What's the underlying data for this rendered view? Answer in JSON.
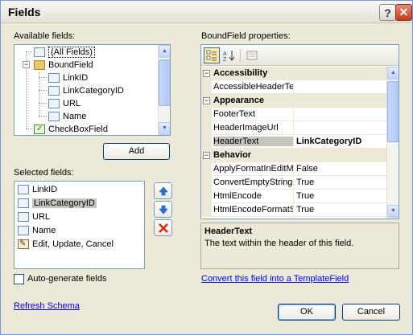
{
  "window": {
    "title": "Fields"
  },
  "available": {
    "label": "Available fields:",
    "items": [
      {
        "label": "(All Fields)",
        "icon": "all-fields-icon"
      },
      {
        "label": "BoundField",
        "icon": "bound-field-icon"
      },
      {
        "label": "LinkID",
        "icon": "field-icon"
      },
      {
        "label": "LinkCategoryID",
        "icon": "field-icon"
      },
      {
        "label": "URL",
        "icon": "field-icon"
      },
      {
        "label": "Name",
        "icon": "field-icon"
      },
      {
        "label": "CheckBoxField",
        "icon": "checkbox-field-icon"
      }
    ],
    "expander_symbol": "−"
  },
  "buttons": {
    "add": "Add",
    "ok": "OK",
    "cancel": "Cancel"
  },
  "selected": {
    "label": "Selected fields:",
    "items": [
      {
        "label": "LinkID",
        "icon": "field-icon"
      },
      {
        "label": "LinkCategoryID",
        "icon": "field-icon",
        "selected": true
      },
      {
        "label": "URL",
        "icon": "field-icon"
      },
      {
        "label": "Name",
        "icon": "field-icon"
      },
      {
        "label": "Edit, Update, Cancel",
        "icon": "command-field-icon"
      }
    ]
  },
  "autogen": {
    "label": "Auto-generate fields",
    "checked": false
  },
  "links": {
    "refresh": "Refresh Schema",
    "convert": "Convert this field into a TemplateField"
  },
  "properties": {
    "label": "BoundField properties:",
    "rows": [
      {
        "type": "category",
        "name": "Accessibility"
      },
      {
        "type": "prop",
        "name": "AccessibleHeaderTe",
        "value": ""
      },
      {
        "type": "category",
        "name": "Appearance"
      },
      {
        "type": "prop",
        "name": "FooterText",
        "value": ""
      },
      {
        "type": "prop",
        "name": "HeaderImageUrl",
        "value": ""
      },
      {
        "type": "prop",
        "name": "HeaderText",
        "value": "LinkCategoryID",
        "selected": true
      },
      {
        "type": "category",
        "name": "Behavior"
      },
      {
        "type": "prop",
        "name": "ApplyFormatInEditM",
        "value": "False"
      },
      {
        "type": "prop",
        "name": "ConvertEmptyString",
        "value": "True"
      },
      {
        "type": "prop",
        "name": "HtmlEncode",
        "value": "True"
      },
      {
        "type": "prop",
        "name": "HtmlEncodeFormatS",
        "value": "True"
      }
    ],
    "description": {
      "title": "HeaderText",
      "text": "The text within the header of this field."
    }
  },
  "colors": {
    "selection": "#316ac5",
    "accent_border": "#7f9db9",
    "face": "#ece9d8",
    "link": "#0000ee"
  }
}
